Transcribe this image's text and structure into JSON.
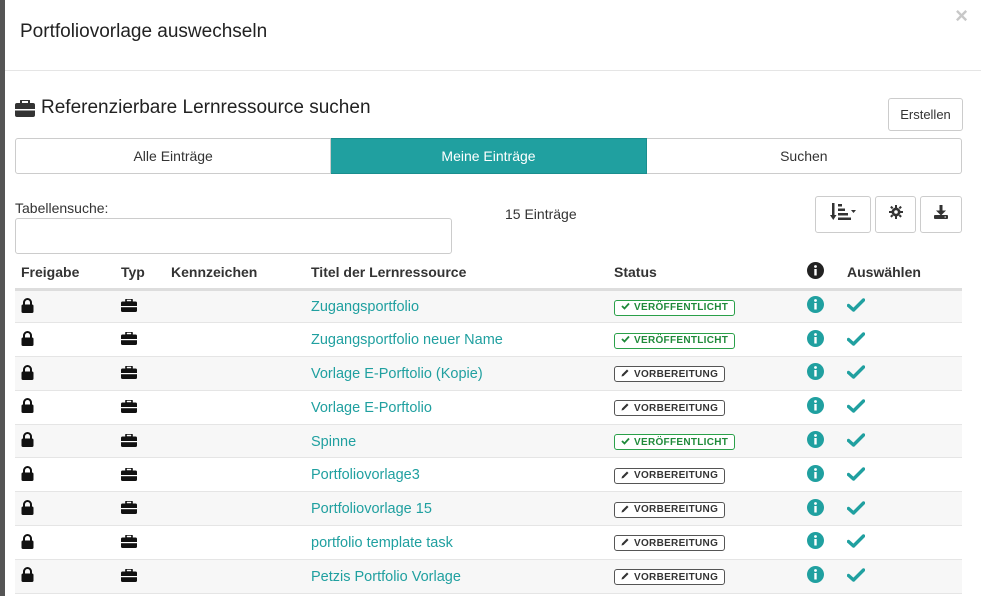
{
  "modal": {
    "title": "Portfoliovorlage auswechseln",
    "close_symbol": "×"
  },
  "section": {
    "title": "Referenzierbare Lernressource suchen",
    "create_label": "Erstellen"
  },
  "tabs": [
    {
      "label": "Alle Einträge",
      "active": false
    },
    {
      "label": "Meine Einträge",
      "active": true
    },
    {
      "label": "Suchen",
      "active": false
    }
  ],
  "search": {
    "label": "Tabellensuche:",
    "value": "",
    "placeholder": ""
  },
  "count_label": "15 Einträge",
  "toolbar": {
    "sort_icon": "sort-amount-icon",
    "settings_icon": "gear-icon",
    "download_icon": "download-icon"
  },
  "table": {
    "headers": {
      "freigabe": "Freigabe",
      "typ": "Typ",
      "kennzeichen": "Kennzeichen",
      "titel": "Titel der Lernressource",
      "status": "Status",
      "info_icon": "info-circle-icon",
      "auswaehlen": "Auswählen"
    },
    "rows": [
      {
        "title": "Zugangsportfolio",
        "status": "VERÖFFENTLICHT",
        "kennzeichen": ""
      },
      {
        "title": "Zugangsportfolio neuer Name",
        "status": "VERÖFFENTLICHT",
        "kennzeichen": ""
      },
      {
        "title": "Vorlage E-Porftolio (Kopie)",
        "status": "VORBEREITUNG",
        "kennzeichen": ""
      },
      {
        "title": "Vorlage E-Porftolio",
        "status": "VORBEREITUNG",
        "kennzeichen": ""
      },
      {
        "title": "Spinne",
        "status": "VERÖFFENTLICHT",
        "kennzeichen": ""
      },
      {
        "title": "Portfoliovorlage3",
        "status": "VORBEREITUNG",
        "kennzeichen": ""
      },
      {
        "title": "Portfoliovorlage 15",
        "status": "VORBEREITUNG",
        "kennzeichen": ""
      },
      {
        "title": "portfolio template task",
        "status": "VORBEREITUNG",
        "kennzeichen": ""
      },
      {
        "title": "Petzis Portfolio Vorlage",
        "status": "VORBEREITUNG",
        "kennzeichen": ""
      }
    ]
  },
  "colors": {
    "accent": "#20a0a0",
    "published": "#1f8a3a",
    "prepared": "#333333"
  }
}
